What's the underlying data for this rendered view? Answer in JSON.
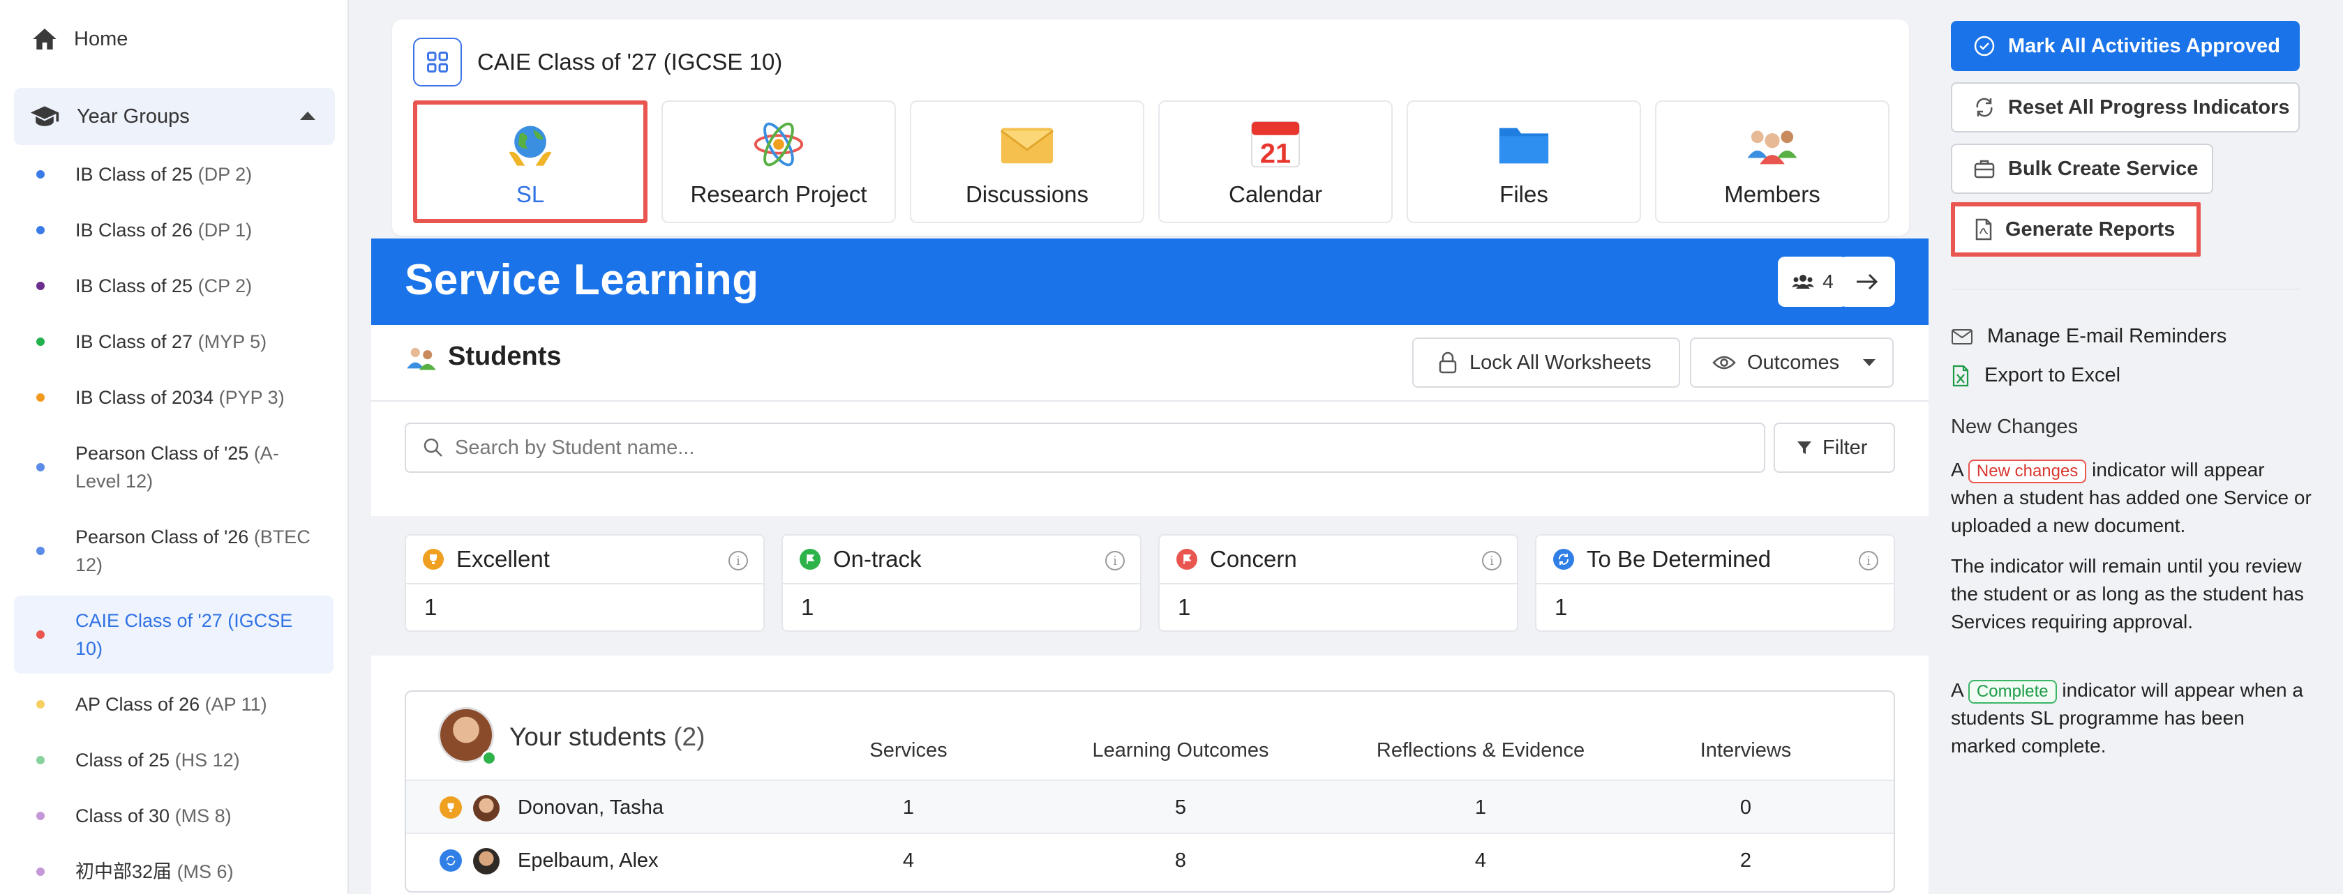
{
  "sidebar": {
    "home_label": "Home",
    "year_groups_label": "Year Groups",
    "groups": [
      {
        "name": "IB Class of 25",
        "code": "(DP 2)",
        "color": "#3b7be8"
      },
      {
        "name": "IB Class of 26",
        "code": "(DP 1)",
        "color": "#3b7be8"
      },
      {
        "name": "IB Class of 25",
        "code": "(CP 2)",
        "color": "#6b2d8e"
      },
      {
        "name": "IB Class of 27",
        "code": "(MYP 5)",
        "color": "#22b14c"
      },
      {
        "name": "IB Class of 2034",
        "code": "(PYP 3)",
        "color": "#f29a1f"
      },
      {
        "name": "Pearson Class of '25",
        "code": "(A-Level 12)",
        "color": "#5b8de8"
      },
      {
        "name": "Pearson Class of '26",
        "code": "(BTEC 12)",
        "color": "#5b8de8"
      },
      {
        "name": "CAIE Class of '27",
        "code": "(IGCSE 10)",
        "color": "#e8564f"
      },
      {
        "name": "AP Class of 26",
        "code": "(AP 11)",
        "color": "#f7cf61"
      },
      {
        "name": "Class of 25",
        "code": "(HS 12)",
        "color": "#86d19c"
      },
      {
        "name": "Class of 30",
        "code": "(MS 8)",
        "color": "#c497d8"
      },
      {
        "name": "初中部32届",
        "code": "(MS 6)",
        "color": "#c497d8"
      }
    ]
  },
  "header": {
    "title": "CAIE Class of '27 (IGCSE 10)",
    "tiles": [
      {
        "label": "SL",
        "icon": "globe-hands-icon"
      },
      {
        "label": "Research Project",
        "icon": "atom-icon"
      },
      {
        "label": "Discussions",
        "icon": "envelope-icon"
      },
      {
        "label": "Calendar",
        "icon": "calendar-icon",
        "day": "21"
      },
      {
        "label": "Files",
        "icon": "folder-icon"
      },
      {
        "label": "Members",
        "icon": "people-icon"
      }
    ]
  },
  "banner": {
    "title": "Service Learning",
    "member_count": "4"
  },
  "students": {
    "heading": "Students",
    "lock_label": "Lock All Worksheets",
    "outcomes_label": "Outcomes",
    "search_placeholder": "Search by Student name...",
    "filter_label": "Filter"
  },
  "stats": [
    {
      "label": "Excellent",
      "value": "1",
      "color": "#f0a020"
    },
    {
      "label": "On-track",
      "value": "1",
      "color": "#2db34a"
    },
    {
      "label": "Concern",
      "value": "1",
      "color": "#e8564f"
    },
    {
      "label": "To Be Determined",
      "value": "1",
      "color": "#2f7fe6"
    }
  ],
  "table": {
    "heading": "Your students",
    "count": "(2)",
    "columns": [
      "Services",
      "Learning Outcomes",
      "Reflections & Evidence",
      "Interviews"
    ],
    "rows": [
      {
        "name": "Donovan, Tasha",
        "status_color": "#f0a020",
        "values": [
          "1",
          "5",
          "1",
          "0"
        ]
      },
      {
        "name": "Epelbaum, Alex",
        "status_color": "#2f7fe6",
        "values": [
          "4",
          "8",
          "4",
          "2"
        ]
      }
    ]
  },
  "actions": {
    "approve": "Mark All Activities Approved",
    "reset": "Reset All Progress Indicators",
    "bulk": "Bulk Create Service",
    "reports": "Generate Reports",
    "reminders": "Manage E-mail Reminders",
    "export": "Export to Excel"
  },
  "new_changes": {
    "title": "New Changes",
    "p1_prefix": "A",
    "p1_tag": "New changes",
    "p1_suffix": "indicator will appear when a student has added one Service or uploaded a new document.",
    "p2": "The indicator will remain until you review the student or as long as the student has Services requiring approval.",
    "p3_prefix": "A",
    "p3_tag": "Complete",
    "p3_suffix": "indicator will appear when a students SL programme has been marked complete."
  }
}
